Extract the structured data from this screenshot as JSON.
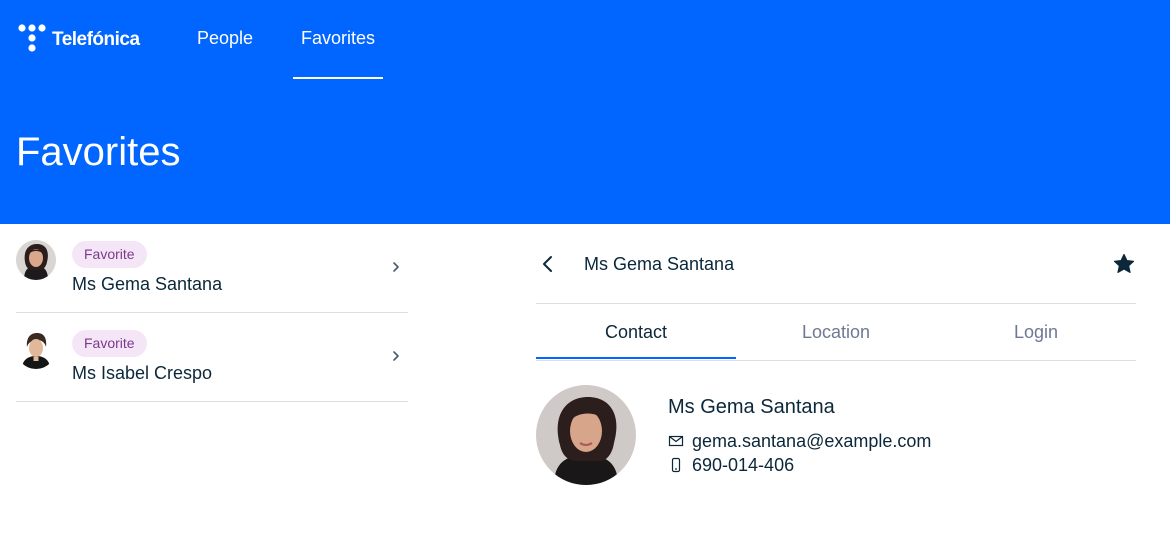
{
  "brand": {
    "logo_text": "Telefónica",
    "primary_color": "#0066ff"
  },
  "nav": {
    "items": [
      {
        "label": "People",
        "active": false
      },
      {
        "label": "Favorites",
        "active": true
      }
    ]
  },
  "page": {
    "title": "Favorites"
  },
  "list": {
    "items": [
      {
        "badge": "Favorite",
        "name": "Ms Gema Santana",
        "icon": "chevron-right-icon"
      },
      {
        "badge": "Favorite",
        "name": "Ms Isabel Crespo",
        "icon": "chevron-right-icon"
      }
    ]
  },
  "detail": {
    "title": "Ms Gema Santana",
    "favorite_icon": "star-filled-icon",
    "back_icon": "chevron-left-icon",
    "tabs": [
      {
        "label": "Contact",
        "active": true
      },
      {
        "label": "Location",
        "active": false
      },
      {
        "label": "Login",
        "active": false
      }
    ],
    "contact": {
      "name": "Ms Gema Santana",
      "email": "gema.santana@example.com",
      "phone": "690-014-406"
    }
  }
}
